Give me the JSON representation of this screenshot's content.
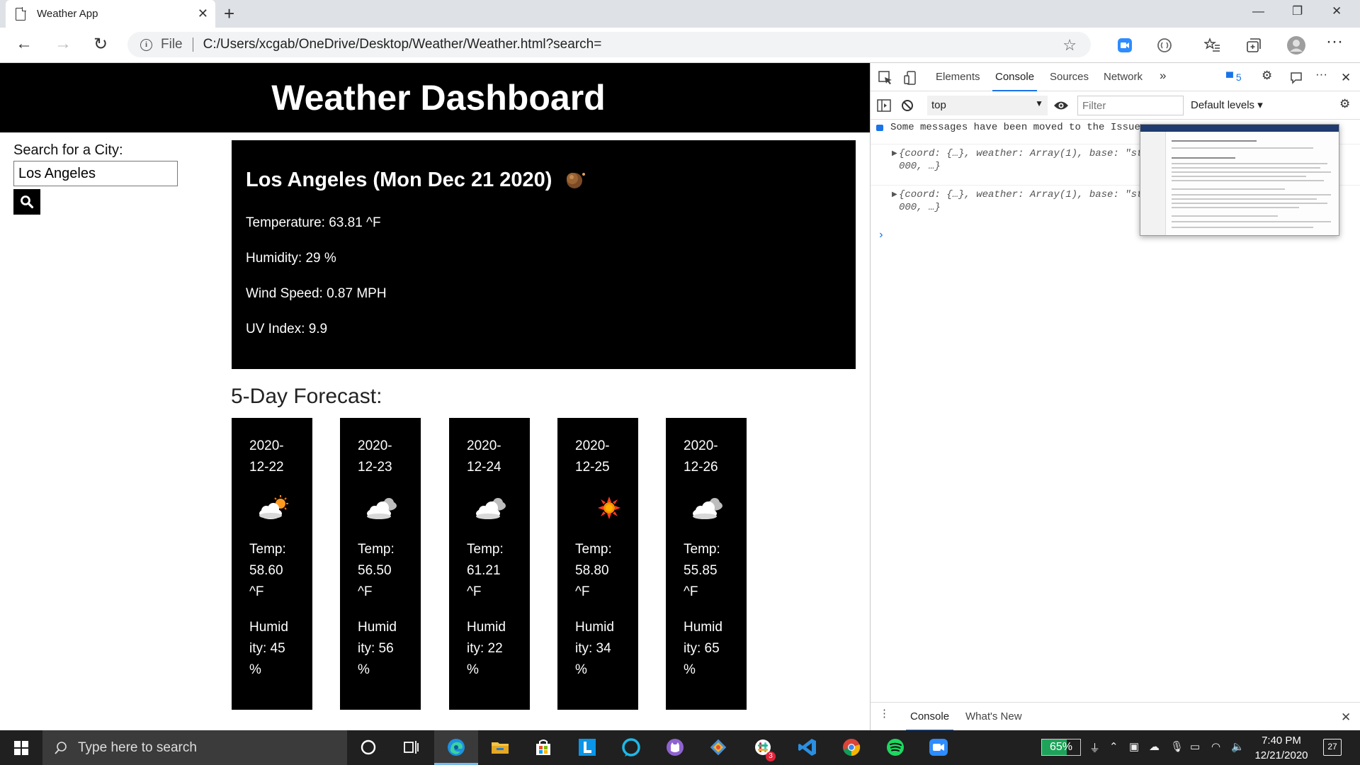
{
  "browser": {
    "tab_title": "Weather App",
    "file_label": "File",
    "url": "C:/Users/xcgab/OneDrive/Desktop/Weather/Weather.html?search="
  },
  "app": {
    "title": "Weather Dashboard",
    "search_label": "Search for a City:",
    "search_value": "Los Angeles",
    "current": {
      "heading": "Los Angeles (Mon Dec 21 2020)",
      "temperature": "Temperature: 63.81 ^F",
      "humidity": "Humidity: 29 %",
      "wind": "Wind Speed: 0.87 MPH",
      "uv": "UV Index: 9.9",
      "icon": "night-moon-icon"
    },
    "forecast_title": "5-Day Forecast:",
    "forecast": [
      {
        "date_a": "2020-",
        "date_b": "12-22",
        "icon": "partly-sunny-icon",
        "temp_a": "Temp:",
        "temp_b": "58.60",
        "temp_c": "^F",
        "hum_a": "Humid",
        "hum_b": "ity: 45",
        "hum_c": "%"
      },
      {
        "date_a": "2020-",
        "date_b": "12-23",
        "icon": "cloud-icon",
        "temp_a": "Temp:",
        "temp_b": "56.50",
        "temp_c": "^F",
        "hum_a": "Humid",
        "hum_b": "ity: 56",
        "hum_c": "%"
      },
      {
        "date_a": "2020-",
        "date_b": "12-24",
        "icon": "cloud-icon",
        "temp_a": "Temp:",
        "temp_b": "61.21",
        "temp_c": "^F",
        "hum_a": "Humid",
        "hum_b": "ity: 22",
        "hum_c": "%"
      },
      {
        "date_a": "2020-",
        "date_b": "12-25",
        "icon": "sun-icon",
        "temp_a": "Temp:",
        "temp_b": "58.80",
        "temp_c": "^F",
        "hum_a": "Humid",
        "hum_b": "ity: 34",
        "hum_c": "%"
      },
      {
        "date_a": "2020-",
        "date_b": "12-26",
        "icon": "cloud-icon",
        "temp_a": "Temp:",
        "temp_b": "55.85",
        "temp_c": "^F",
        "hum_a": "Humid",
        "hum_b": "ity: 65",
        "hum_c": "%"
      }
    ]
  },
  "devtools": {
    "tabs": [
      "Elements",
      "Console",
      "Sources",
      "Network"
    ],
    "issues_count": "5",
    "context": "top",
    "filter_placeholder": "Filter",
    "levels": "Default levels",
    "issues_msg": "Some messages have been moved to the Issues",
    "logs": [
      {
        "line1": "{coord: {…}, weather: Array(1), base: \"st",
        "line2": "000, …}"
      },
      {
        "line1": "{coord: {…}, weather: Array(1), base: \"st",
        "line2": "000, …}"
      }
    ],
    "drawer_tabs": [
      "Console",
      "What's New"
    ]
  },
  "taskbar": {
    "search_placeholder": "Type here to search",
    "battery": "65%",
    "time": "7:40 PM",
    "date": "12/21/2020",
    "notifications": "27",
    "badge_count": "3"
  },
  "colors": {
    "accent": "#1a73e8",
    "card_bg": "#000000",
    "taskbar": "#202020"
  }
}
